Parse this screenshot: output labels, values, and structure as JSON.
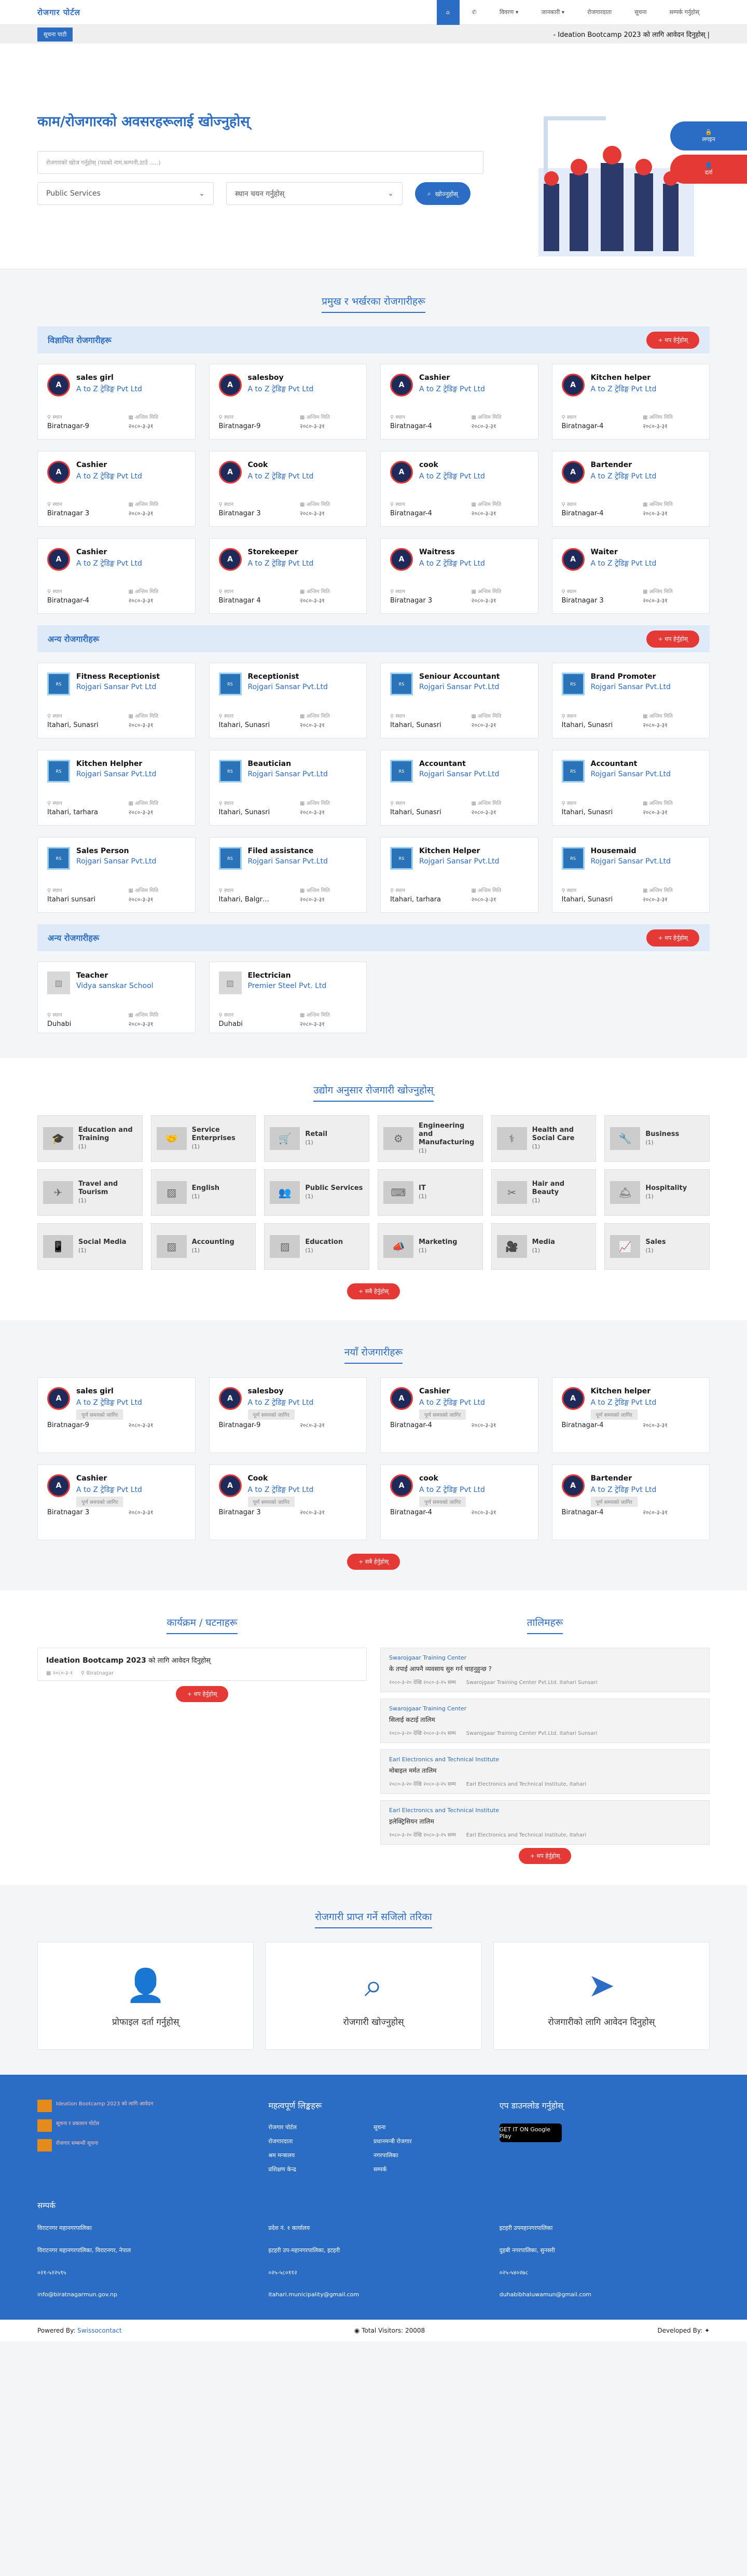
{
  "header": {
    "brand": "रोजगार पोर्टल",
    "nav": [
      "",
      "",
      "विवरण ▾",
      "जानकारी ▾",
      "रोजगारदाता",
      "सूचना",
      "सम्पर्क गर्नुहोस्"
    ]
  },
  "ticker": {
    "button": "सूचना पाटी",
    "text": "- Ideation Bootcamp 2023 को लागि आवेदन दिनुहोस् |"
  },
  "hero": {
    "title": "काम/रोजगारको अवसरहरूलाई खोज्नुहोस्",
    "search_placeholder": "रोजगारको खोज गर्नुहोस् (पदको नाम,कम्पनी,ठाउँ .....)",
    "select1": "Public Services",
    "select2": "स्थान चयन गर्नुहोस्",
    "search_btn": "खोज्नुहोस्",
    "side1": "लगइन",
    "side2": "दर्ता"
  },
  "jobs_section": {
    "title": "प्रमुख र भर्खरका रोजगारीहरू",
    "more": "+ थप हेर्नुहोस्"
  },
  "cats": [
    {
      "title": "विज्ञापित रोजगारीहरू",
      "jobs": [
        {
          "t": "sales girl",
          "c": "A to Z ट्रेडिङ्ग Pvt Ltd",
          "l": "Biratnagar-9",
          "d": "२०८०-३-३१"
        },
        {
          "t": "salesboy",
          "c": "A to Z ट्रेडिङ्ग Pvt Ltd",
          "l": "Biratnagar-9",
          "d": "२०८०-३-३१"
        },
        {
          "t": "Cashier",
          "c": "A to Z ट्रेडिङ्ग Pvt Ltd",
          "l": "Biratnagar-4",
          "d": "२०८०-३-३१"
        },
        {
          "t": "Kitchen helper",
          "c": "A to Z ट्रेडिङ्ग Pvt Ltd",
          "l": "Biratnagar-4",
          "d": "२०८०-३-३१"
        },
        {
          "t": "Cashier",
          "c": "A to Z ट्रेडिङ्ग Pvt Ltd",
          "l": "Biratnagar 3",
          "d": "२०८०-३-३१"
        },
        {
          "t": "Cook",
          "c": "A to Z ट्रेडिङ्ग Pvt Ltd",
          "l": "Biratnagar 3",
          "d": "२०८०-३-३१"
        },
        {
          "t": "cook",
          "c": "A to Z ट्रेडिङ्ग Pvt Ltd",
          "l": "Biratnagar-4",
          "d": "२०८०-३-३१"
        },
        {
          "t": "Bartender",
          "c": "A to Z ट्रेडिङ्ग Pvt Ltd",
          "l": "Biratnagar-4",
          "d": "२०८०-३-३१"
        },
        {
          "t": "Cashier",
          "c": "A to Z ट्रेडिङ्ग Pvt Ltd",
          "l": "Biratnagar-4",
          "d": "२०८०-३-३१"
        },
        {
          "t": "Storekeeper",
          "c": "A to Z ट्रेडिङ्ग Pvt Ltd",
          "l": "Biratnagar 4",
          "d": "२०८०-३-३१"
        },
        {
          "t": "Waitress",
          "c": "A to Z ट्रेडिङ्ग Pvt Ltd",
          "l": "Biratnagar 3",
          "d": "२०८०-३-३१"
        },
        {
          "t": "Waiter",
          "c": "A to Z ट्रेडिङ्ग Pvt Ltd",
          "l": "Biratnagar 3",
          "d": "२०८०-३-३१"
        }
      ]
    },
    {
      "title": "अन्य रोजगारीहरू",
      "jobs": [
        {
          "t": "Fitness Receptionist",
          "c": "Rojgari Sansar Pvt Ltd",
          "l": "Itahari, Sunasri",
          "d": "२०८०-३-३१"
        },
        {
          "t": "Receptionist",
          "c": "Rojgari Sansar Pvt.Ltd",
          "l": "Itahari, Sunasri",
          "d": "२०८०-३-३१"
        },
        {
          "t": "Seniour Accountant",
          "c": "Rojgari Sansar Pvt.Ltd",
          "l": "Itahari, Sunasri",
          "d": "२०८०-३-३१"
        },
        {
          "t": "Brand Promoter",
          "c": "Rojgari Sansar Pvt.Ltd",
          "l": "Itahari, Sunasri",
          "d": "२०८०-३-३१"
        },
        {
          "t": "Kitchen Helpher",
          "c": "Rojgari Sansar Pvt.Ltd",
          "l": "Itahari, tarhara",
          "d": "२०८०-३-३१"
        },
        {
          "t": "Beautician",
          "c": "Rojgari Sansar Pvt.Ltd",
          "l": "Itahari, Sunasri",
          "d": "२०८०-३-३१"
        },
        {
          "t": "Accountant",
          "c": "Rojgari Sansar Pvt.Ltd",
          "l": "Itahari, Sunasri",
          "d": "२०८०-३-३१"
        },
        {
          "t": "Accountant",
          "c": "Rojgari Sansar Pvt.Ltd",
          "l": "Itahari, Sunasri",
          "d": "२०८०-३-३१"
        },
        {
          "t": "Sales Person",
          "c": "Rojgari Sansar Pvt.Ltd",
          "l": "Itahari sunsari",
          "d": "२०८०-३-३१"
        },
        {
          "t": "Filed assistance",
          "c": "Rojgari Sansar Pvt.Ltd",
          "l": "Itahari, Balgr…",
          "d": "२०८०-३-३१"
        },
        {
          "t": "Kitchen Helper",
          "c": "Rojgari Sansar Pvt.Ltd",
          "l": "Itahari, tarhara",
          "d": "२०८०-३-३१"
        },
        {
          "t": "Housemaid",
          "c": "Rojgari Sansar Pvt.Ltd",
          "l": "Itahari, Sunasri",
          "d": "२०८०-३-३१"
        }
      ]
    },
    {
      "title": "अन्य रोजगारीहरू",
      "jobs": [
        {
          "t": "Teacher",
          "c": "Vidya sanskar School",
          "l": "Duhabi",
          "d": "२०८०-३-३१"
        },
        {
          "t": "Electrician",
          "c": "Premier Steel Pvt. Ltd",
          "l": "Duhabi",
          "d": "२०८०-३-३१"
        }
      ]
    }
  ],
  "labels": {
    "loc": "स्थान",
    "deadline": "अन्तिम मिति"
  },
  "industry": {
    "title": "उद्योग अनुसार रोजगारी खोज्नुहोस्",
    "items": [
      "Education and Training",
      "Service Enterprises",
      "Retail",
      "Engineering and Manufacturing",
      "Health and Social Care",
      "Business",
      "Travel and Tourism",
      "English",
      "Public Services",
      "IT",
      "Hair and Beauty",
      "Hospitality",
      "Social Media",
      "Accounting",
      "Education",
      "Marketing",
      "Media",
      "Sales"
    ],
    "count": "(1)",
    "more": "+ सबै हेर्नुहोस्"
  },
  "featured": {
    "title": "नयाँ रोजगारीहरू",
    "badge": "पूर्ण समयको जागिर",
    "more": "+ सबै हेर्नुहोस्"
  },
  "events": {
    "title": "कार्यक्रम / घटनाहरू",
    "name": "Ideation Bootcamp 2023",
    "suffix": "को लागि आवेदन दिनुहोस्",
    "date": "२०८०-३-१",
    "place": "Biratnagar",
    "more": "+ थप हेर्नुहोस्"
  },
  "training": {
    "title": "तालिमहरू",
    "items": [
      {
        "o": "Swarojgaar Training Center",
        "n": "के तपाई आफ्नै व्यवसाय सुरु गर्न चाहनुहुन्छ ?",
        "m": "२०८०-३-२० देखि २०८०-३-२५ सम्म",
        "p": "Swarojgaar Training Center Pvt.Ltd. Itahari Sunsari"
      },
      {
        "o": "Swarojgaar Training Center",
        "n": "सिलाई कटाई तालिम",
        "m": "२०८०-३-२० देखि २०८०-३-२५ सम्म",
        "p": "Swarojgaar Training Center Pvt.Ltd. Itahari Sunsari"
      },
      {
        "o": "Earl Electronics and Technical Institute",
        "n": "मोबाइल मर्मत तालिम",
        "m": "२०८०-३-२० देखि २०८०-३-२५ सम्म",
        "p": "Earl Electronics and Technical Institute, Itahari"
      },
      {
        "o": "Earl Electronics and Technical Institute",
        "n": "इलेक्ट्रिसियन तालिम",
        "m": "२०८०-३-२० देखि २०८०-३-२५ सम्म",
        "p": "Earl Electronics and Technical Institute, Itahari"
      }
    ],
    "more": "+ थप हेर्नुहोस्"
  },
  "steps": {
    "title": "रोजगारी प्राप्त गर्ने सजिलो तरिका",
    "items": [
      "प्रोफाइल दर्ता गर्नुहोस्",
      "रोजगारी खोज्नुहोस्",
      "रोजगारीको लागि आवेदन दिनुहोस्"
    ]
  },
  "footer": {
    "news": [
      "Ideation Bootcamp 2023 को लागि आवेदन",
      "सूचना र प्रकाशन पोर्टल",
      "रोजगार सम्बन्धी सूचना"
    ],
    "links_title": "महत्वपूर्ण लिङ्कहरू",
    "links": [
      "रोजगार पोर्टल",
      "सूचना",
      "रोजगारदाता",
      "प्रधानमन्त्री रोजगार",
      "श्रम मन्त्रालय",
      "नगरपालिका",
      "प्रशिक्षण केन्द्र",
      "सम्पर्क"
    ],
    "app_title": "एप डाउनलोड गर्नुहोस्",
    "app": "GET IT ON Google Play",
    "contact_title": "सम्पर्क",
    "contacts": [
      "विराटनगर महानगरपालिका",
      "प्रदेश नं. १ कार्यालय",
      "इटहरी उपमहानगरपालिका",
      "विराटनगर महानगरपालिका, विराटनगर, नेपाल",
      "इटहरी उप-महानगरपालिका, इटहरी",
      "दुहबी नगरपालिका, सुनसरी",
      "०२१-५२२५९५",
      "०२५-५८०११२",
      "०२५-५४०२७८",
      "info@biratnagarmun.gov.np",
      "itahari.municipality@gmail.com",
      "duhabibhaluwamun@gmail.com"
    ]
  },
  "bottom": {
    "powered": "Powered By:",
    "company": "Swissocontact",
    "visitors": "Total Visitors: 20008",
    "dev": "Developed By:"
  }
}
